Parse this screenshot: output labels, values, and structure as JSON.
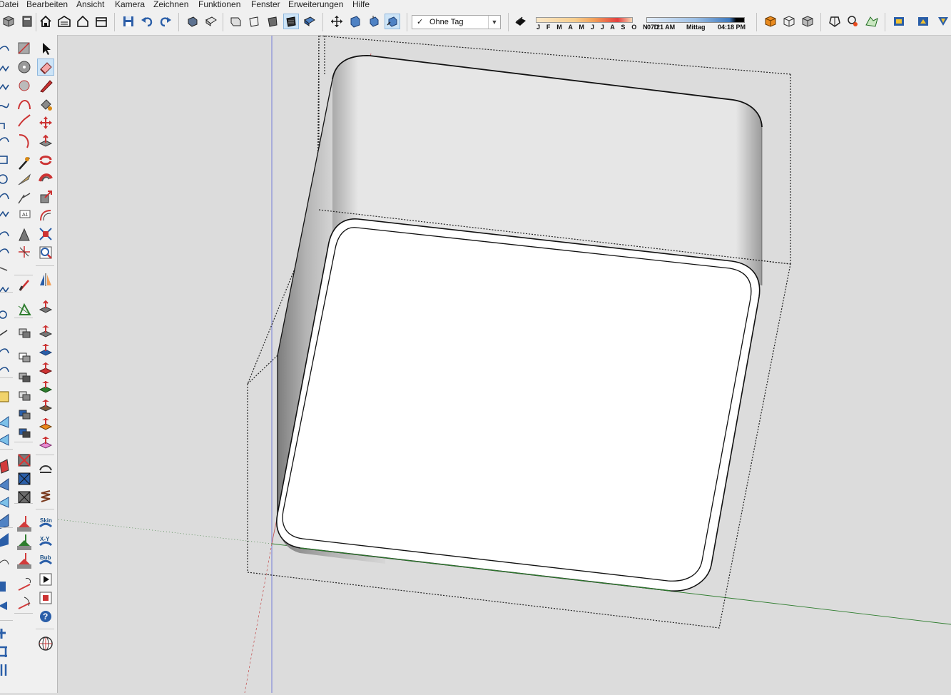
{
  "menu": [
    "Datei",
    "Bearbeiten",
    "Ansicht",
    "Kamera",
    "Zeichnen",
    "Funktionen",
    "Fenster",
    "Erweiterungen",
    "Hilfe"
  ],
  "tag_select": {
    "value": "Ohne Tag"
  },
  "shadow": {
    "months_label": "J F M A M J J A S O N D",
    "time_start": "07:21 AM",
    "time_mid": "Mittag",
    "time_end": "04:18 PM"
  },
  "left_labels": {
    "skin": "Skin",
    "xy": "X-Y",
    "bub": "Bub"
  },
  "icons": {
    "toolbar": [
      "component-icon",
      "book-icon",
      "home-icon",
      "warehouse-icon",
      "house-icon",
      "shop-icon",
      "save-icon",
      "undo-icon",
      "redo-icon",
      "view-iso-icon",
      "view-top-icon",
      "view-front-icon",
      "view-right-icon",
      "view-back-icon",
      "view-left-icon",
      "view-bottom-icon",
      "orbit-icon",
      "pan-icon",
      "zoom-icon",
      "zoom-extents-icon",
      "shadow-icon",
      "box-orange-icon",
      "box-white-icon",
      "box-gray-icon",
      "solid-tools-icon",
      "outer-shell-icon",
      "sandbox-icon",
      "export-icon",
      "layout-icon",
      "style-icon"
    ],
    "colors": {
      "toolbar_bg": "#f0f0f0",
      "viewport_bg": "#dcdcdc",
      "active_bg": "#cde4f7",
      "red_axis": "#b83b3b",
      "green_axis": "#2e7d2e",
      "blue_axis": "#3b4fcf"
    }
  }
}
